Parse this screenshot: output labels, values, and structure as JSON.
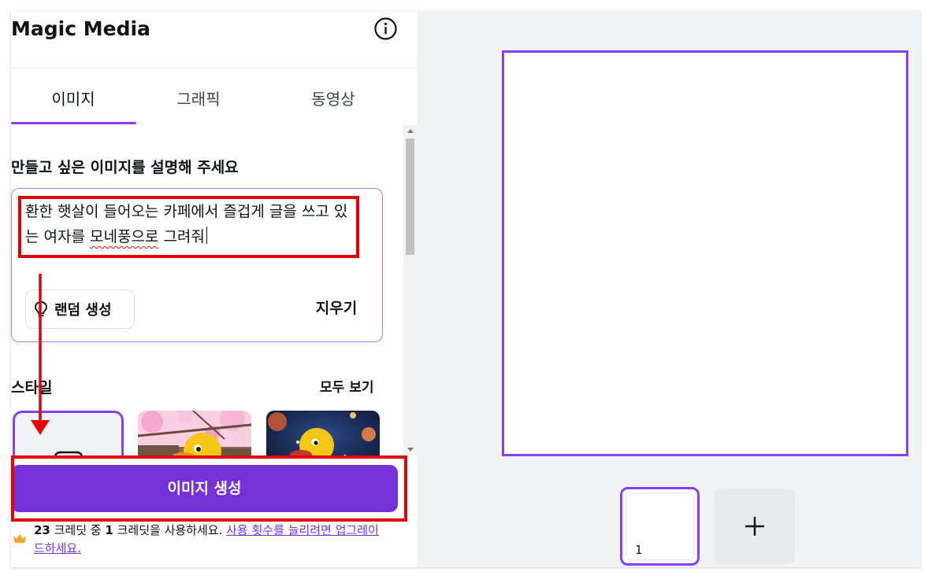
{
  "panel": {
    "title": "Magic Media",
    "tabs": [
      {
        "label": "이미지",
        "active": true
      },
      {
        "label": "그래픽",
        "active": false
      },
      {
        "label": "동영상",
        "active": false
      }
    ],
    "prompt_label": "만들고 싶은 이미지를 설명해 주세요",
    "prompt_text_a": "환한 햇살이 들어오는 카페에서 즐겁게 글을 쓰고 있는 여자를 ",
    "prompt_text_misspelled": "모네풍으로",
    "prompt_text_b": " 그려줘",
    "random_button": "랜덤 생성",
    "clear_button": "지우기",
    "style_label": "스타일",
    "see_all": "모두 보기",
    "generate_button": "이미지 생성",
    "credits": {
      "count_text": "23",
      "text_a": " 크레딧 중 ",
      "used": "1",
      "text_b": " 크레딧을 사용하세요. ",
      "upgrade_link": "사용 횟수를 늘리려면 업그레이드하세요."
    }
  },
  "pages": {
    "current_page": "1"
  },
  "colors": {
    "accent": "#8b3dff",
    "button": "#7731d8",
    "annotation": "#e50000"
  },
  "icons": [
    "info-icon",
    "lightbulb-icon",
    "crown-icon",
    "plus-icon",
    "no-style-icon"
  ]
}
